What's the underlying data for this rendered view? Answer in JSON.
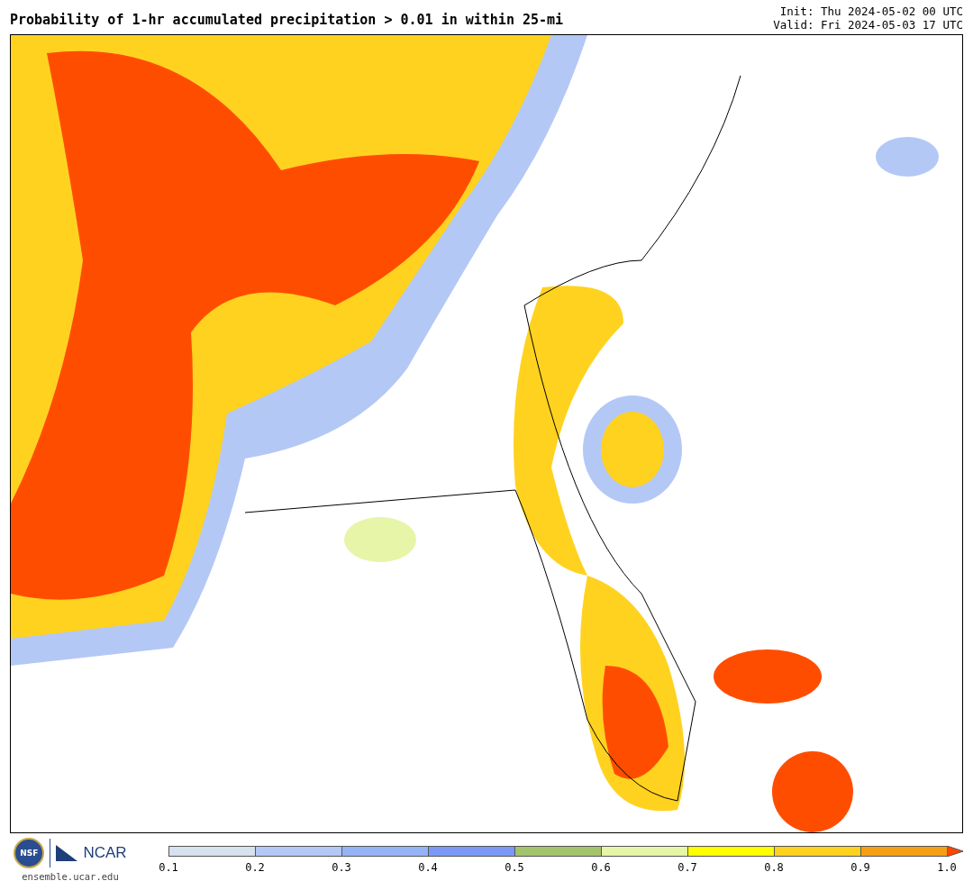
{
  "title": "Probability of 1-hr accumulated precipitation > 0.01 in within 25-mi",
  "init": "Init: Thu 2024-05-02 00 UTC",
  "valid": "Valid: Fri 2024-05-03 17 UTC",
  "logos": {
    "nsf": "NSF",
    "ncar": "NCAR",
    "site": "ensemble.ucar.edu"
  },
  "colorbar": {
    "segments": [
      {
        "color": "#d6e2ed"
      },
      {
        "color": "#b4c8f6"
      },
      {
        "color": "#95b3f7"
      },
      {
        "color": "#7b98f5"
      },
      {
        "color": "#a3c46a"
      },
      {
        "color": "#e6f5a8"
      },
      {
        "color": "#ffff00"
      },
      {
        "color": "#ffd21f"
      },
      {
        "color": "#f5a012"
      }
    ],
    "extension": {
      "color": "#ff4500"
    },
    "ticks": [
      "0.1",
      "0.2",
      "0.3",
      "0.4",
      "0.5",
      "0.6",
      "0.7",
      "0.8",
      "0.9",
      "1.0"
    ]
  }
}
